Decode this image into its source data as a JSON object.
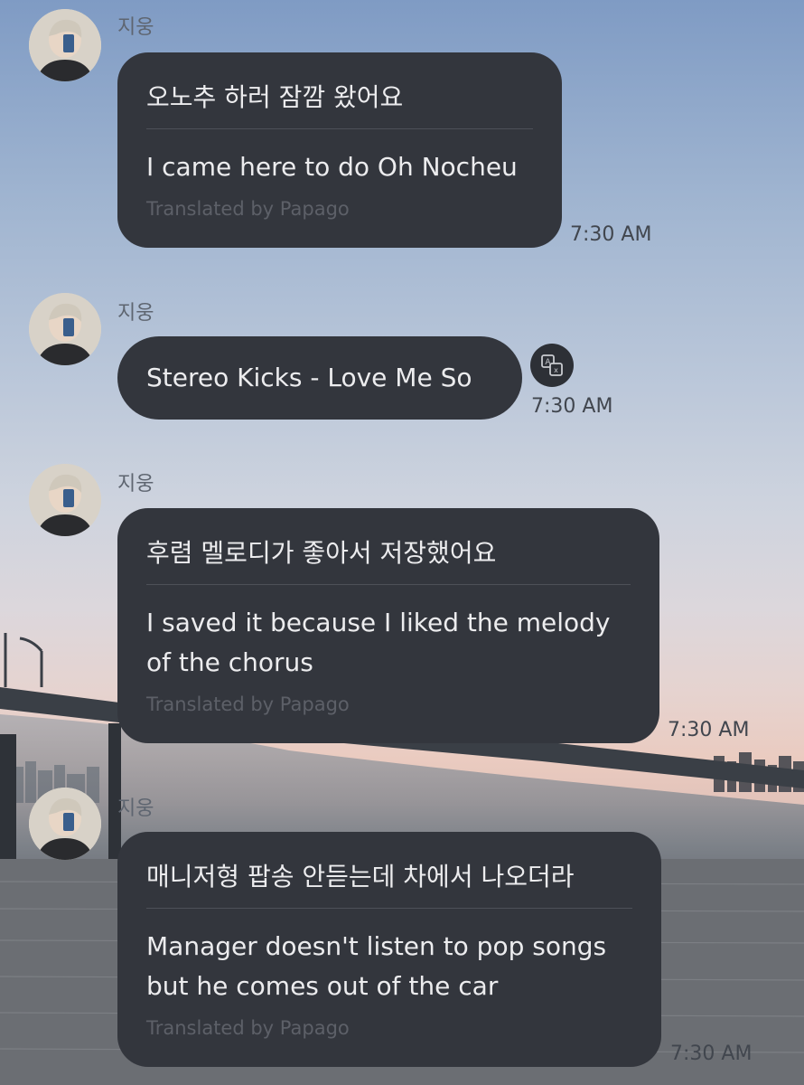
{
  "messages": [
    {
      "sender": "지웅",
      "original": "오노추 하러 잠깜 왔어요",
      "translation": "I came here to do Oh Nocheu",
      "credit": "Translated by Papago",
      "time": "7:30 AM"
    },
    {
      "sender": "지웅",
      "text": "Stereo Kicks - Love Me So",
      "time": "7:30 AM",
      "action_icon": "translate-icon"
    },
    {
      "sender": "지웅",
      "original": "후렴 멜로디가 좋아서 저장했어요",
      "translation": "I saved it because I liked the melody of the chorus",
      "credit": "Translated by Papago",
      "time": "7:30 AM"
    },
    {
      "sender": "지웅",
      "original": "매니저형 팝송 안듣는데 차에서 나오더라",
      "translation": "Manager doesn't listen to pop songs but he comes out of the car",
      "credit": "Translated by Papago",
      "time": "7:30 AM"
    }
  ],
  "colors": {
    "bubble": "#33363d",
    "bubble_text": "#ececee",
    "meta_text": "#5d6068"
  }
}
